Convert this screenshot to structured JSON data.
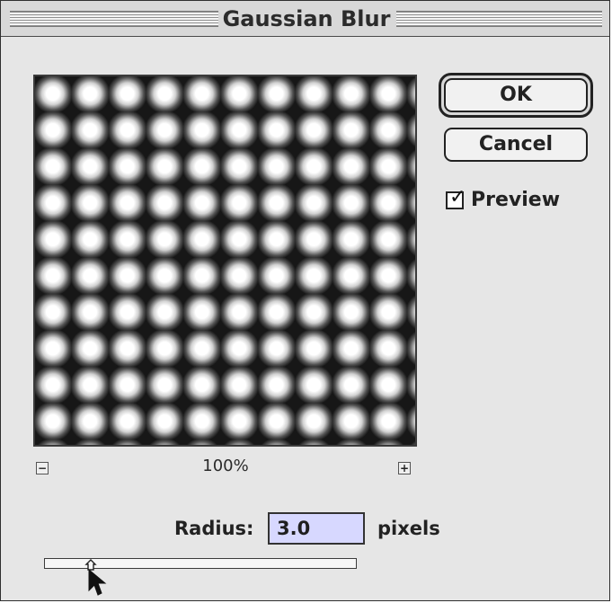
{
  "window": {
    "title": "Gaussian Blur"
  },
  "buttons": {
    "ok": "OK",
    "cancel": "Cancel",
    "minus": "−",
    "plus": "+"
  },
  "preview": {
    "label": "Preview",
    "checked": true,
    "zoom": "100%"
  },
  "radius": {
    "label": "Radius:",
    "value": "3.0",
    "units": "pixels"
  },
  "icons": {
    "checkbox": "checkmark-icon",
    "slider_thumb": "slider-thumb-icon",
    "cursor": "pointer-cursor-icon"
  },
  "colors": {
    "window_bg": "#e6e6e6",
    "input_highlight": "#d7d8ff",
    "preview_bg": "#171717",
    "preview_dots": "#ffffff"
  }
}
